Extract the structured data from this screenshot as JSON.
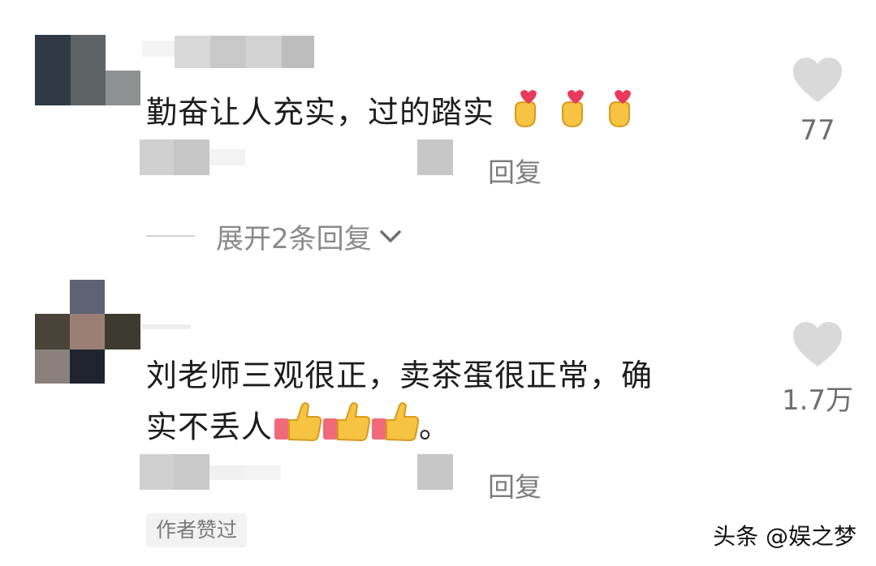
{
  "comments": [
    {
      "text": "勤奋让人充实，过的踏实",
      "emoji_icon": "finger-heart-icon",
      "emoji_count": 3,
      "reply_label": "回复",
      "likes": "77",
      "expand_label": "展开2条回复"
    },
    {
      "text_line1": "刘老师三观很正，卖茶蛋很正常，确",
      "text_line2": "实不丢人",
      "text_suffix": "。",
      "emoji_icon": "thumbs-up-icon",
      "emoji_count": 3,
      "reply_label": "回复",
      "likes": "1.7万",
      "badge": "作者赞过"
    }
  ],
  "watermark": "头条 @娱之梦",
  "colors": {
    "heart": "#d9d9d9",
    "secondary_text": "#7d7d7d",
    "primary_text": "#1c1c1c"
  }
}
